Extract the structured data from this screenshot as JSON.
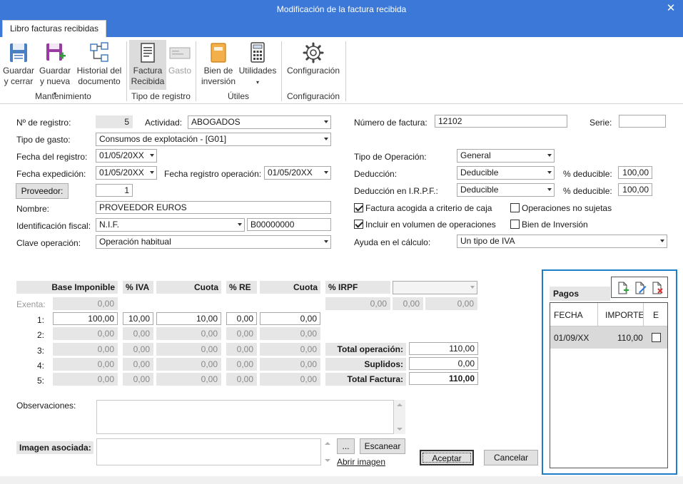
{
  "window": {
    "title": "Modificación de la factura recibida",
    "close_glyph": "✕"
  },
  "tab": {
    "label": "Libro facturas recibidas"
  },
  "ribbon": {
    "guardar_cerrar": [
      "Guardar",
      "y cerrar"
    ],
    "guardar_nueva": [
      "Guardar",
      "y nueva"
    ],
    "historial": [
      "Historial del",
      "documento"
    ],
    "factura_recibida": [
      "Factura",
      "Recibida"
    ],
    "gasto": "Gasto",
    "bien_inversion": [
      "Bien de",
      "inversión"
    ],
    "utilidades": "Utilidades",
    "configuracion": "Configuración",
    "groups": {
      "mantenimiento": "Mantenimiento",
      "tipo_registro": "Tipo de registro",
      "utiles": "Útiles",
      "configuracion": "Configuración"
    }
  },
  "form": {
    "n_registro_label": "Nº de registro:",
    "n_registro": "5",
    "actividad_label": "Actividad:",
    "actividad": "ABOGADOS",
    "tipo_gasto_label": "Tipo de gasto:",
    "tipo_gasto": "Consumos de explotación - [G01]",
    "fecha_registro_label": "Fecha del registro:",
    "fecha_registro": "01/05/20XX",
    "fecha_expedicion_label": "Fecha expedición:",
    "fecha_expedicion": "01/05/20XX",
    "fecha_reg_operacion_label": "Fecha registro operación:",
    "fecha_reg_operacion": "01/05/20XX",
    "proveedor_button": "Proveedor:",
    "proveedor": "1",
    "nombre_label": "Nombre:",
    "nombre": "PROVEEDOR EUROS",
    "identificacion_label": "Identificación fiscal:",
    "identificacion_tipo": "N.I.F.",
    "identificacion": "B00000000",
    "clave_label": "Clave operación:",
    "clave": "Operación habitual",
    "numero_factura_label": "Número de factura:",
    "numero_factura": "12102",
    "serie_label": "Serie:",
    "serie": "",
    "tipo_operacion_label": "Tipo de Operación:",
    "tipo_operacion": "General",
    "deduccion_label": "Deducción:",
    "deduccion": "Deducible",
    "pct_deducible_label": "% deducible:",
    "pct_deducible": "100,00",
    "deduccion_irpf_label": "Deducción en I.R.P.F.:",
    "deduccion_irpf": "Deducible",
    "pct_deducible2_label": "% deducible:",
    "pct_deducible2": "100,00",
    "chk_caja_label": "Factura acogida a criterio de caja",
    "chk_caja": true,
    "chk_no_sujetas_label": "Operaciones no sujetas",
    "chk_no_sujetas": false,
    "chk_volumen_label": "Incluir en  volumen de operaciones",
    "chk_volumen": true,
    "chk_bien_label": "Bien de Inversión",
    "chk_bien": false,
    "ayuda_label": "Ayuda en el cálculo:",
    "ayuda": "Un tipo de IVA"
  },
  "grid": {
    "headers": {
      "base": "Base Imponible",
      "iva": "% IVA",
      "cuota": "Cuota",
      "re": "% RE",
      "cuota_re": "Cuota",
      "irpf": "% IRPF"
    },
    "exenta_label": "Exenta:",
    "exenta": "0,00",
    "rows": [
      {
        "label": "1:",
        "base": "100,00",
        "iva": "10,00",
        "cuota": "10,00",
        "re": "0,00",
        "cuota_re": "0,00"
      },
      {
        "label": "2:",
        "base": "0,00",
        "iva": "0,00",
        "cuota": "0,00",
        "re": "0,00",
        "cuota_re": "0,00"
      },
      {
        "label": "3:",
        "base": "0,00",
        "iva": "0,00",
        "cuota": "0,00",
        "re": "0,00",
        "cuota_re": "0,00"
      },
      {
        "label": "4:",
        "base": "0,00",
        "iva": "0,00",
        "cuota": "0,00",
        "re": "0,00",
        "cuota_re": "0,00"
      },
      {
        "label": "5:",
        "base": "0,00",
        "iva": "0,00",
        "cuota": "0,00",
        "re": "0,00",
        "cuota_re": "0,00"
      }
    ],
    "irpf_row": [
      "0,00",
      "0,00",
      "0,00"
    ],
    "total_operacion_label": "Total operación:",
    "total_operacion": "110,00",
    "suplidos_label": "Suplidos:",
    "suplidos": "0,00",
    "total_factura_label": "Total Factura:",
    "total_factura": "110,00"
  },
  "observaciones_label": "Observaciones:",
  "imagen_label": "Imagen asociada:",
  "browse_button": "...",
  "escanear_button": "Escanear",
  "abrir_imagen_link": "Abrir imagen",
  "aceptar_button": "Aceptar",
  "cancelar_button": "Cancelar",
  "pagos": {
    "title": "Pagos",
    "headers": {
      "fecha": "FECHA",
      "importe": "IMPORTE",
      "e": "E"
    },
    "rows": [
      {
        "fecha": "01/09/XX",
        "importe": "110,00",
        "e": false
      }
    ]
  }
}
